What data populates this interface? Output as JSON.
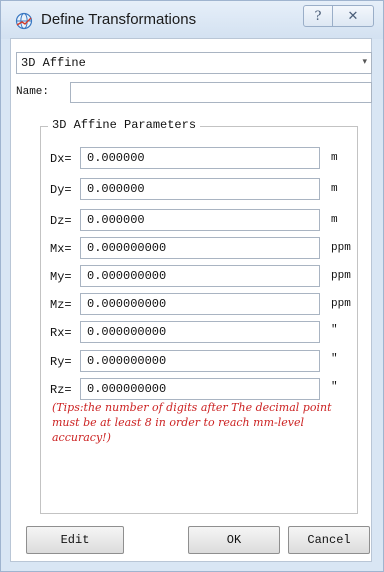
{
  "window": {
    "title": "Define Transformations",
    "help_glyph": "?",
    "close_glyph": "✕"
  },
  "type_select": {
    "value": "3D Affine",
    "arrow": "▾"
  },
  "name": {
    "label": "Name:",
    "value": ""
  },
  "group": {
    "legend": "3D Affine Parameters",
    "params": [
      {
        "label": "Dx=",
        "value": "0.000000",
        "unit": "m"
      },
      {
        "label": "Dy=",
        "value": "0.000000",
        "unit": "m"
      },
      {
        "label": "Dz=",
        "value": "0.000000",
        "unit": "m"
      },
      {
        "label": "Mx=",
        "value": "0.000000000",
        "unit": "ppm"
      },
      {
        "label": "My=",
        "value": "0.000000000",
        "unit": "ppm"
      },
      {
        "label": "Mz=",
        "value": "0.000000000",
        "unit": "ppm"
      },
      {
        "label": "Rx=",
        "value": "0.000000000",
        "unit": "″"
      },
      {
        "label": "Ry=",
        "value": "0.000000000",
        "unit": "″"
      },
      {
        "label": "Rz=",
        "value": "0.000000000",
        "unit": "″"
      }
    ],
    "tips": "(Tips:the number of digits after The decimal point must be at least 8 in order to reach mm-level accuracy!)"
  },
  "buttons": {
    "edit": "Edit",
    "ok": "OK",
    "cancel": "Cancel"
  },
  "colors": {
    "tips_text": "#cc2222",
    "window_frame": "#d9e6f4"
  }
}
